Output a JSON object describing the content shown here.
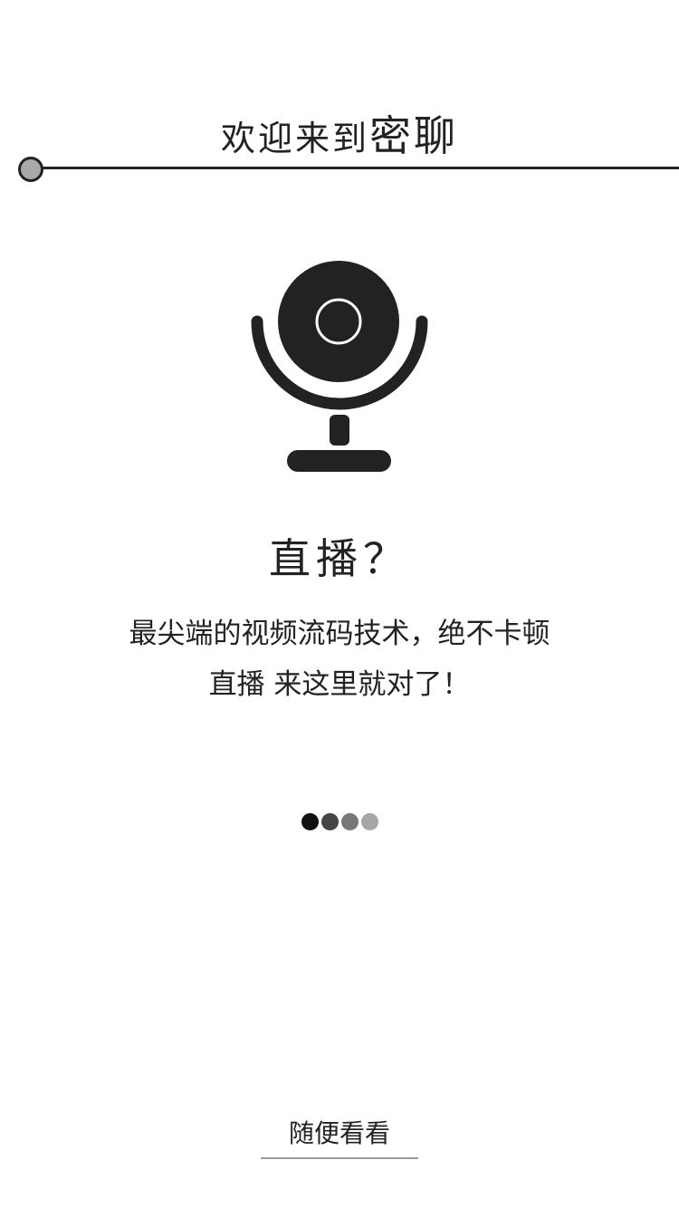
{
  "header": {
    "title_prefix": "欢迎来到",
    "title_brand": "密聊"
  },
  "feature": {
    "icon": "webcam-icon",
    "title": "直播？",
    "description_lines": [
      "最尖端的视频流码技术，绝不卡顿",
      "直播 来这里就对了！"
    ]
  },
  "pager": {
    "total": 4,
    "active_index": 0,
    "dot_colors": [
      "#111111",
      "#444444",
      "#777777",
      "#a6a6a6"
    ]
  },
  "actions": {
    "browse_label": "随便看看"
  },
  "colors": {
    "ink": "#222222",
    "accent_dot": "#a9a9a9",
    "underline": "#9a9a9a",
    "background": "#ffffff"
  }
}
